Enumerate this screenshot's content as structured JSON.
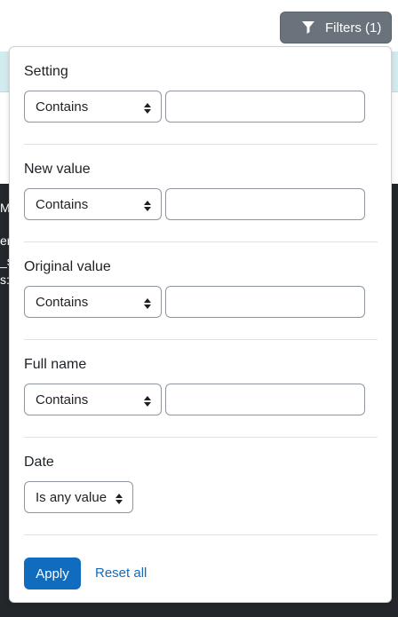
{
  "background": {
    "fragments": [
      "M",
      "ers",
      "_s",
      "s:"
    ]
  },
  "toolbar": {
    "filters_label": "Filters (1)",
    "filter_icon": "funnel-icon"
  },
  "filters": [
    {
      "label": "Setting",
      "operator": "Contains",
      "value": ""
    },
    {
      "label": "New value",
      "operator": "Contains",
      "value": ""
    },
    {
      "label": "Original value",
      "operator": "Contains",
      "value": ""
    },
    {
      "label": "Full name",
      "operator": "Contains",
      "value": ""
    },
    {
      "label": "Date",
      "operator": "Is any value"
    }
  ],
  "actions": {
    "apply_label": "Apply",
    "reset_label": "Reset all"
  },
  "colors": {
    "primary": "#0f6cbf",
    "filters_button": "#6a737b",
    "dark_background": "#23272b",
    "info_band": "#d2ebee"
  }
}
